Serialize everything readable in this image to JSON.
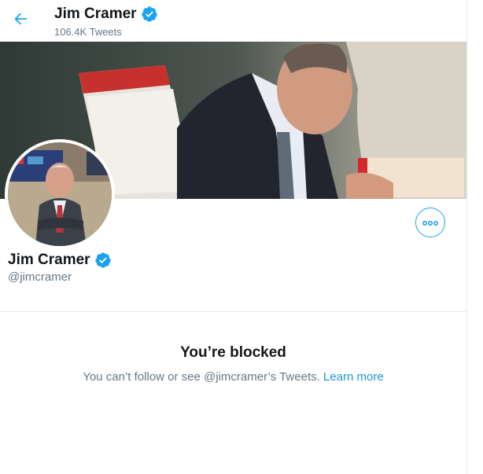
{
  "header": {
    "back_icon": "arrow-left-icon",
    "name": "Jim Cramer",
    "tweet_count": "106.4K",
    "tweets_label": "Tweets"
  },
  "profile": {
    "name": "Jim Cramer",
    "handle": "@jimcramer",
    "verified_icon": "verified-badge-icon",
    "more_icon": "more-options-icon"
  },
  "blocked": {
    "title": "You’re blocked",
    "message": "You can’t follow or see @jimcramer’s Tweets.",
    "learn_more": "Learn more"
  },
  "colors": {
    "accent": "#1da1f2",
    "link": "#1b95e0",
    "muted": "#657786",
    "verified": "#1da1f2"
  }
}
